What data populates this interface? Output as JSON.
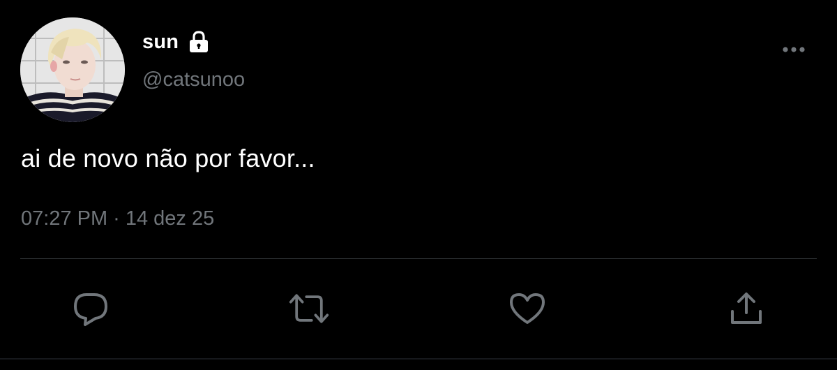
{
  "author": {
    "display_name": "sun",
    "handle": "@catsunoo",
    "protected": true
  },
  "tweet": {
    "text": "ai de novo não por favor...",
    "time": "07:27 PM",
    "separator": "·",
    "date": "14 dez 25"
  },
  "icons": {
    "lock": "lock-icon",
    "more": "more-horizontal-icon",
    "reply": "reply-icon",
    "retweet": "retweet-icon",
    "like": "heart-icon",
    "share": "share-icon"
  },
  "colors": {
    "background": "#000000",
    "primary_text": "#ffffff",
    "secondary_text": "#71767b",
    "divider": "#2f3336",
    "icon": "#71767b"
  }
}
